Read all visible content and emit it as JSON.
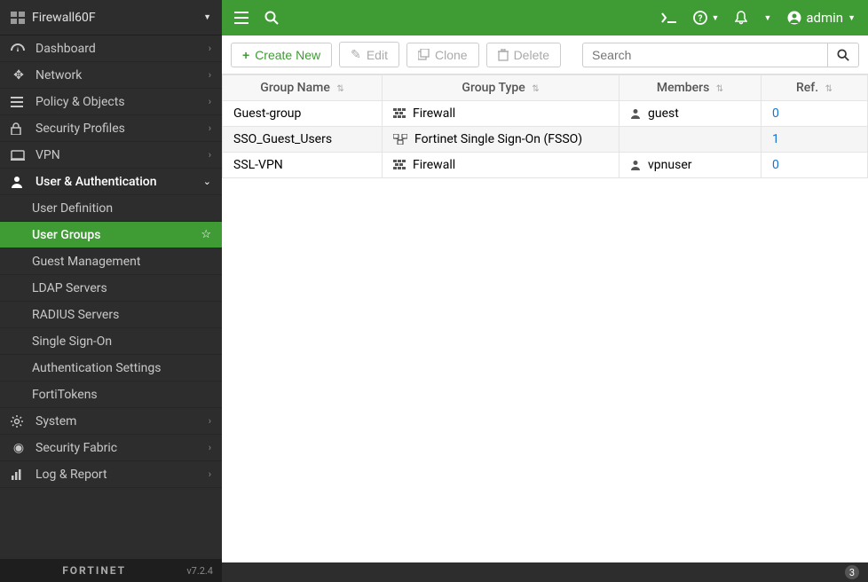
{
  "device_name": "Firewall60F",
  "topbar": {
    "user_label": "admin"
  },
  "sidebar": {
    "items": [
      {
        "icon": "dashboard",
        "label": "Dashboard"
      },
      {
        "icon": "network",
        "label": "Network"
      },
      {
        "icon": "policy",
        "label": "Policy & Objects"
      },
      {
        "icon": "lock",
        "label": "Security Profiles"
      },
      {
        "icon": "vpn",
        "label": "VPN"
      },
      {
        "icon": "user",
        "label": "User & Authentication"
      },
      {
        "icon": "gear",
        "label": "System"
      },
      {
        "icon": "fabric",
        "label": "Security Fabric"
      },
      {
        "icon": "chart",
        "label": "Log & Report"
      }
    ],
    "sub_items": [
      {
        "label": "User Definition"
      },
      {
        "label": "User Groups"
      },
      {
        "label": "Guest Management"
      },
      {
        "label": "LDAP Servers"
      },
      {
        "label": "RADIUS Servers"
      },
      {
        "label": "Single Sign-On"
      },
      {
        "label": "Authentication Settings"
      },
      {
        "label": "FortiTokens"
      }
    ]
  },
  "footer": {
    "brand": "FORTINET",
    "version": "v7.2.4",
    "count": "3"
  },
  "toolbar": {
    "create": "Create New",
    "edit": "Edit",
    "clone": "Clone",
    "delete": "Delete",
    "search_placeholder": "Search"
  },
  "table": {
    "headers": {
      "name": "Group Name",
      "type": "Group Type",
      "members": "Members",
      "ref": "Ref."
    },
    "rows": [
      {
        "name": "Guest-group",
        "type_icon": "firewall",
        "type": "Firewall",
        "member_icon": "user",
        "member": "guest",
        "ref": "0"
      },
      {
        "name": "SSO_Guest_Users",
        "type_icon": "fsso",
        "type": "Fortinet Single Sign-On (FSSO)",
        "member_icon": "",
        "member": "",
        "ref": "1"
      },
      {
        "name": "SSL-VPN",
        "type_icon": "firewall",
        "type": "Firewall",
        "member_icon": "user",
        "member": "vpnuser",
        "ref": "0"
      }
    ]
  }
}
